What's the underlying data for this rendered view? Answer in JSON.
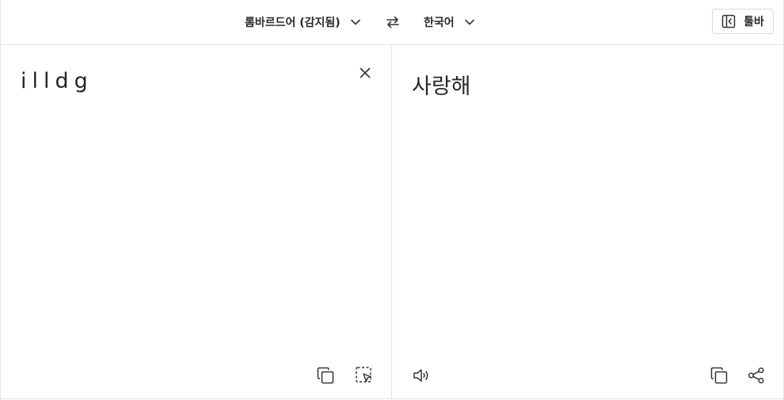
{
  "header": {
    "source_language": "롬바르드어 (감지됨)",
    "target_language": "한국어",
    "toolbar_label": "툴바"
  },
  "source": {
    "text": "illdg"
  },
  "target": {
    "text": "사랑해"
  },
  "icons": {
    "source_dropdown": "chevron-down-icon",
    "swap": "swap-arrows-icon",
    "target_dropdown": "chevron-down-icon",
    "toolbar": "sidebar-collapse-icon",
    "clear": "close-icon",
    "copy_source": "copy-icon",
    "select": "selection-cursor-icon",
    "listen": "speaker-icon",
    "copy_target": "copy-icon",
    "share": "share-icon"
  }
}
